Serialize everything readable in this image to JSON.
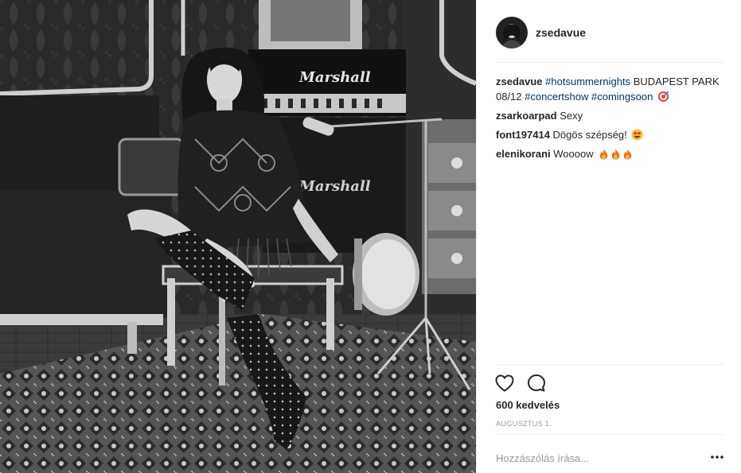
{
  "post": {
    "username": "zsedavue",
    "likes": "600 kedvelés",
    "date": "AUGUSZTUS 1.",
    "comment_placeholder": "Hozzászólás írása...",
    "amp_logo_text": "Marshall"
  },
  "caption": {
    "username": "zsedavue",
    "hashtag1": "#hotsummernights",
    "text1": " BUDAPEST PARK 08/12 ",
    "hashtag2": "#concertshow",
    "hashtag3": "#comingsoon",
    "emoji": "target-emoji"
  },
  "comments": [
    {
      "username": "zsarkoarpad",
      "text": "Sexy"
    },
    {
      "username": "font197414",
      "text": "Dögös szépség!",
      "emoji": "heart-eyes-emoji"
    },
    {
      "username": "elenikorani",
      "text": "Woooow",
      "emoji": "fire-emoji"
    }
  ],
  "icons": {
    "like": "heart-outline-icon",
    "comment": "speech-bubble-icon",
    "more": "more-options-icon"
  },
  "colors": {
    "hashtag": "#003569",
    "text": "#262626",
    "muted": "#999999",
    "divider": "#efefef"
  }
}
